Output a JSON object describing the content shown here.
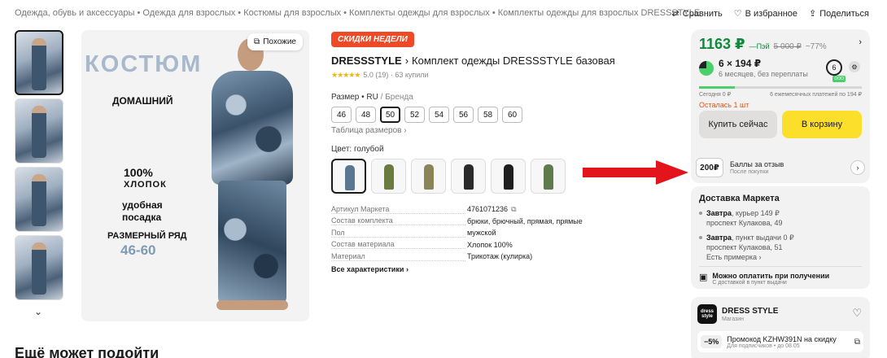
{
  "breadcrumbs": "Одежда, обувь и аксессуары • Одежда для взрослых • Костюмы для взрослых • Комплекты одежды для взрослых • Комплекты одежды для взрослых DRESSSTYLE",
  "top_actions": {
    "compare": "Сравнить",
    "favorites": "В избранное",
    "share": "Поделиться"
  },
  "main_image": {
    "similar": "Похожие",
    "title": "КОСТЮМ",
    "subtitle": "ДОМАШНИЙ",
    "percent": "100%",
    "cotton": "ХЛОПОК",
    "fit": "удобная посадка",
    "size_label": "РАЗМЕРНЫЙ РЯД",
    "size_range": "46-60"
  },
  "product": {
    "badge": "СКИДКИ НЕДЕЛИ",
    "brand": "DRESSSTYLE",
    "title": "Комплект одежды DRESSSTYLE базовая",
    "stars": "★★★★★",
    "rating_text": "5.0 (19) · 63 купили",
    "size_label": "Размер • RU",
    "size_brand": "/ Бренда",
    "sizes": [
      "46",
      "48",
      "50",
      "52",
      "54",
      "56",
      "58",
      "60"
    ],
    "size_table": "Таблица размеров ›",
    "color_label": "Цвет: голубой",
    "colors": [
      "#5b7690",
      "#6b7a3e",
      "#8a8458",
      "#2a2a2a",
      "#1f1f1f",
      "#5f7a4b"
    ],
    "specs": [
      {
        "k": "Артикул Маркета",
        "v": "4761071236"
      },
      {
        "k": "Состав комплекта",
        "v": "брюки, брючный, прямая, прямые"
      },
      {
        "k": "Пол",
        "v": "мужской"
      },
      {
        "k": "Состав материала",
        "v": "Хлопок 100%"
      },
      {
        "k": "Материал",
        "v": "Трикотаж (кулирка)"
      }
    ],
    "all_specs": "Все характеристики ›"
  },
  "price": {
    "main": "1163 ₽",
    "pay": "—Пэй",
    "old": "5 000 ₽",
    "discount": "−77%",
    "split_amount": "6 × 194 ₽",
    "split_sub": "6 месяцев, без переплаты",
    "split_count": "6",
    "split_tag": "ООО",
    "today": "Сегодня 0 ₽",
    "monthly": "6 ежемесячных платежей по 194 ₽",
    "stock": "Осталась 1 шт",
    "buy_now": "Купить сейчас",
    "to_cart": "В корзину"
  },
  "points": {
    "badge": "200₽",
    "title": "Баллы за отзыв",
    "sub": "После покупки"
  },
  "delivery": {
    "title": "Доставка Маркета",
    "item1_bold": "Завтра",
    "item1_rest": ", курьер 149 ₽",
    "item1_addr": "проспект Кулакова, 49",
    "item2_bold": "Завтра",
    "item2_rest": ", пункт выдачи 0 ₽",
    "item2_addr": "проспект Кулакова, 51",
    "fitting": "Есть примерка ›",
    "pay_on_title": "Можно оплатить при получении",
    "pay_on_sub": "С доставкой в пункт выдачи"
  },
  "shop": {
    "logo": "dress style",
    "name": "DRESS STYLE",
    "type": "Магазин",
    "promo_badge": "−5%",
    "promo_title": "Промокод KZHW391N на скидку",
    "promo_sub": "Для подписчиков • до 08.05"
  },
  "more_title": "Ещё может подойти",
  "colors_theme": {
    "price_green": "#0f8a3a",
    "cart_yellow": "#fbdf2a",
    "badge_red": "#ef4a27",
    "arrow_red": "#e3141b"
  }
}
